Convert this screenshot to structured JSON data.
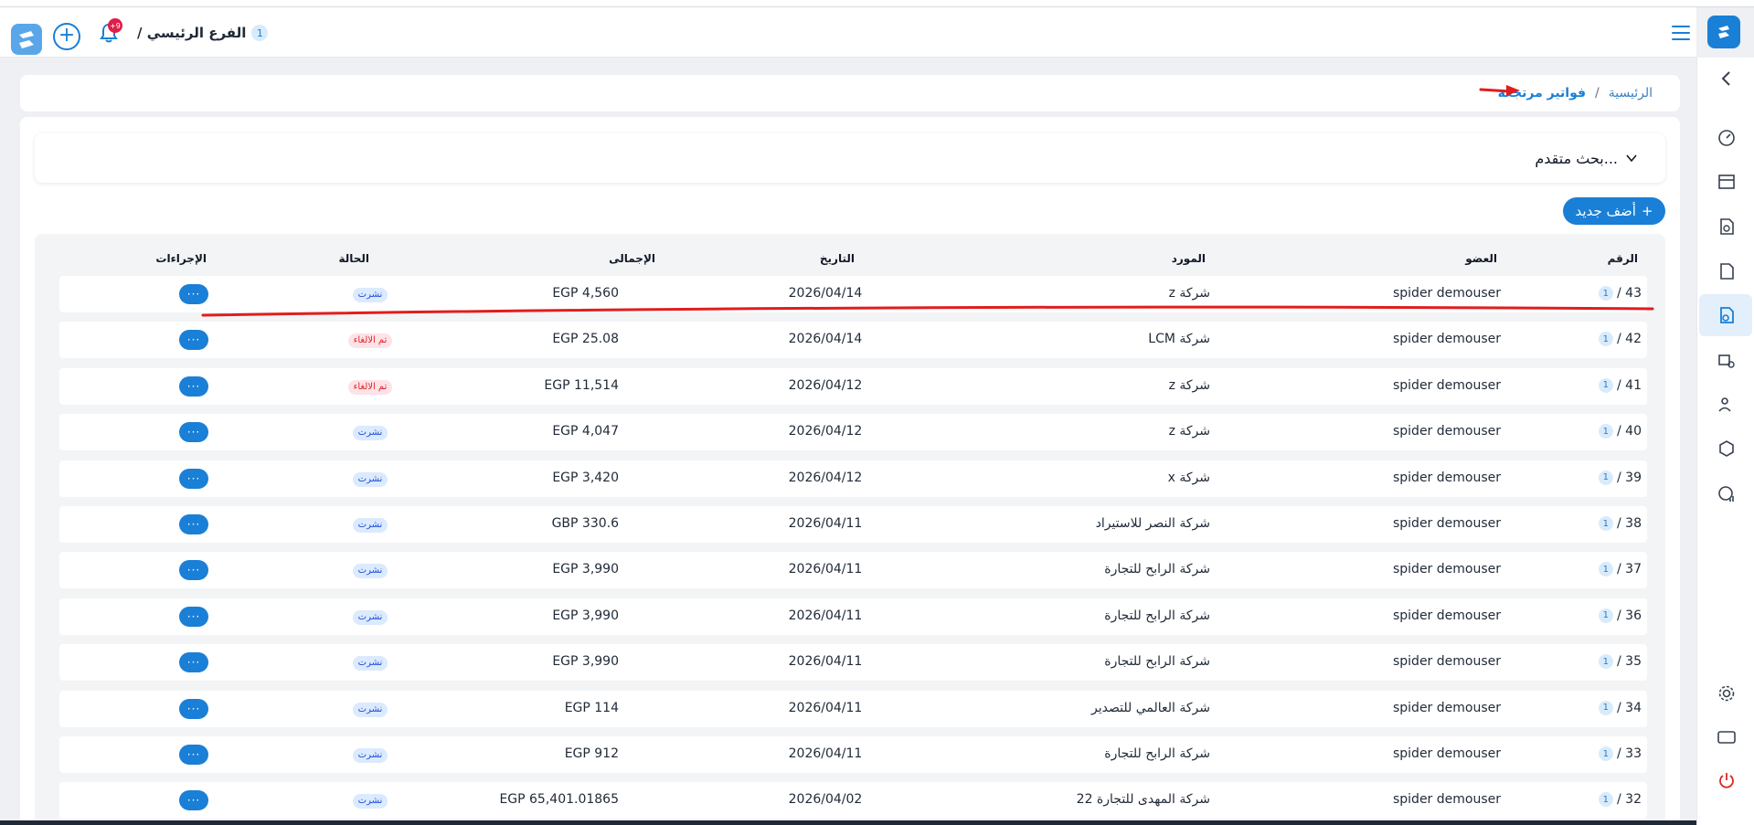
{
  "header": {
    "branch_label": "الفرع الرئيسي /",
    "branch_count": "1",
    "notification_badge": "+9"
  },
  "breadcrumb": {
    "home": "الرئيسية",
    "separator": "/",
    "current": "فواتير مرتجعة"
  },
  "search": {
    "label": "بحث متقدم..."
  },
  "add_button": {
    "label": "أضف جديد"
  },
  "table": {
    "columns": {
      "number": "الرقم",
      "member": "العضو",
      "supplier": "المورد",
      "date": "التاريخ",
      "total": "الإجمالى",
      "status": "الحالة",
      "actions": "الإجراءات"
    },
    "action_label": "···",
    "rows": [
      {
        "number": "43 /",
        "branch": "1",
        "member": "spider demouser",
        "supplier": "شركة z",
        "date": "2026/04/14",
        "total": "EGP 4,560",
        "status": "نشرت",
        "status_type": "pub"
      },
      {
        "number": "42 /",
        "branch": "1",
        "member": "spider demouser",
        "supplier": "شركة LCM",
        "date": "2026/04/14",
        "total": "EGP 25.08",
        "status": "تم الالغاء",
        "status_type": "cancel"
      },
      {
        "number": "41 /",
        "branch": "1",
        "member": "spider demouser",
        "supplier": "شركة z",
        "date": "2026/04/12",
        "total": "EGP 11,514",
        "status": "تم الالغاء",
        "status_type": "cancel"
      },
      {
        "number": "40 /",
        "branch": "1",
        "member": "spider demouser",
        "supplier": "شركة z",
        "date": "2026/04/12",
        "total": "EGP 4,047",
        "status": "نشرت",
        "status_type": "pub"
      },
      {
        "number": "39 /",
        "branch": "1",
        "member": "spider demouser",
        "supplier": "شركة x",
        "date": "2026/04/12",
        "total": "EGP 3,420",
        "status": "نشرت",
        "status_type": "pub"
      },
      {
        "number": "38 /",
        "branch": "1",
        "member": "spider demouser",
        "supplier": "شركة النصر للاستيراد",
        "date": "2026/04/11",
        "total": "GBP 330.6",
        "status": "نشرت",
        "status_type": "pub"
      },
      {
        "number": "37 /",
        "branch": "1",
        "member": "spider demouser",
        "supplier": "شركة الرابح للتجارة",
        "date": "2026/04/11",
        "total": "EGP 3,990",
        "status": "نشرت",
        "status_type": "pub"
      },
      {
        "number": "36 /",
        "branch": "1",
        "member": "spider demouser",
        "supplier": "شركة الرابح للتجارة",
        "date": "2026/04/11",
        "total": "EGP 3,990",
        "status": "نشرت",
        "status_type": "pub"
      },
      {
        "number": "35 /",
        "branch": "1",
        "member": "spider demouser",
        "supplier": "شركة الرابح للتجارة",
        "date": "2026/04/11",
        "total": "EGP 3,990",
        "status": "نشرت",
        "status_type": "pub"
      },
      {
        "number": "34 /",
        "branch": "1",
        "member": "spider demouser",
        "supplier": "شركة العالمي للتصدير",
        "date": "2026/04/11",
        "total": "EGP 114",
        "status": "نشرت",
        "status_type": "pub"
      },
      {
        "number": "33 /",
        "branch": "1",
        "member": "spider demouser",
        "supplier": "شركة الرابح للتجارة",
        "date": "2026/04/11",
        "total": "EGP 912",
        "status": "نشرت",
        "status_type": "pub"
      },
      {
        "number": "32 /",
        "branch": "1",
        "member": "spider demouser",
        "supplier": "شركة المهدى للتجارة 22",
        "date": "2026/04/02",
        "total": "EGP 65,401.01865",
        "status": "نشرت",
        "status_type": "pub"
      }
    ]
  },
  "colors": {
    "accent": "#1a7fd6",
    "danger": "#dc2626"
  }
}
